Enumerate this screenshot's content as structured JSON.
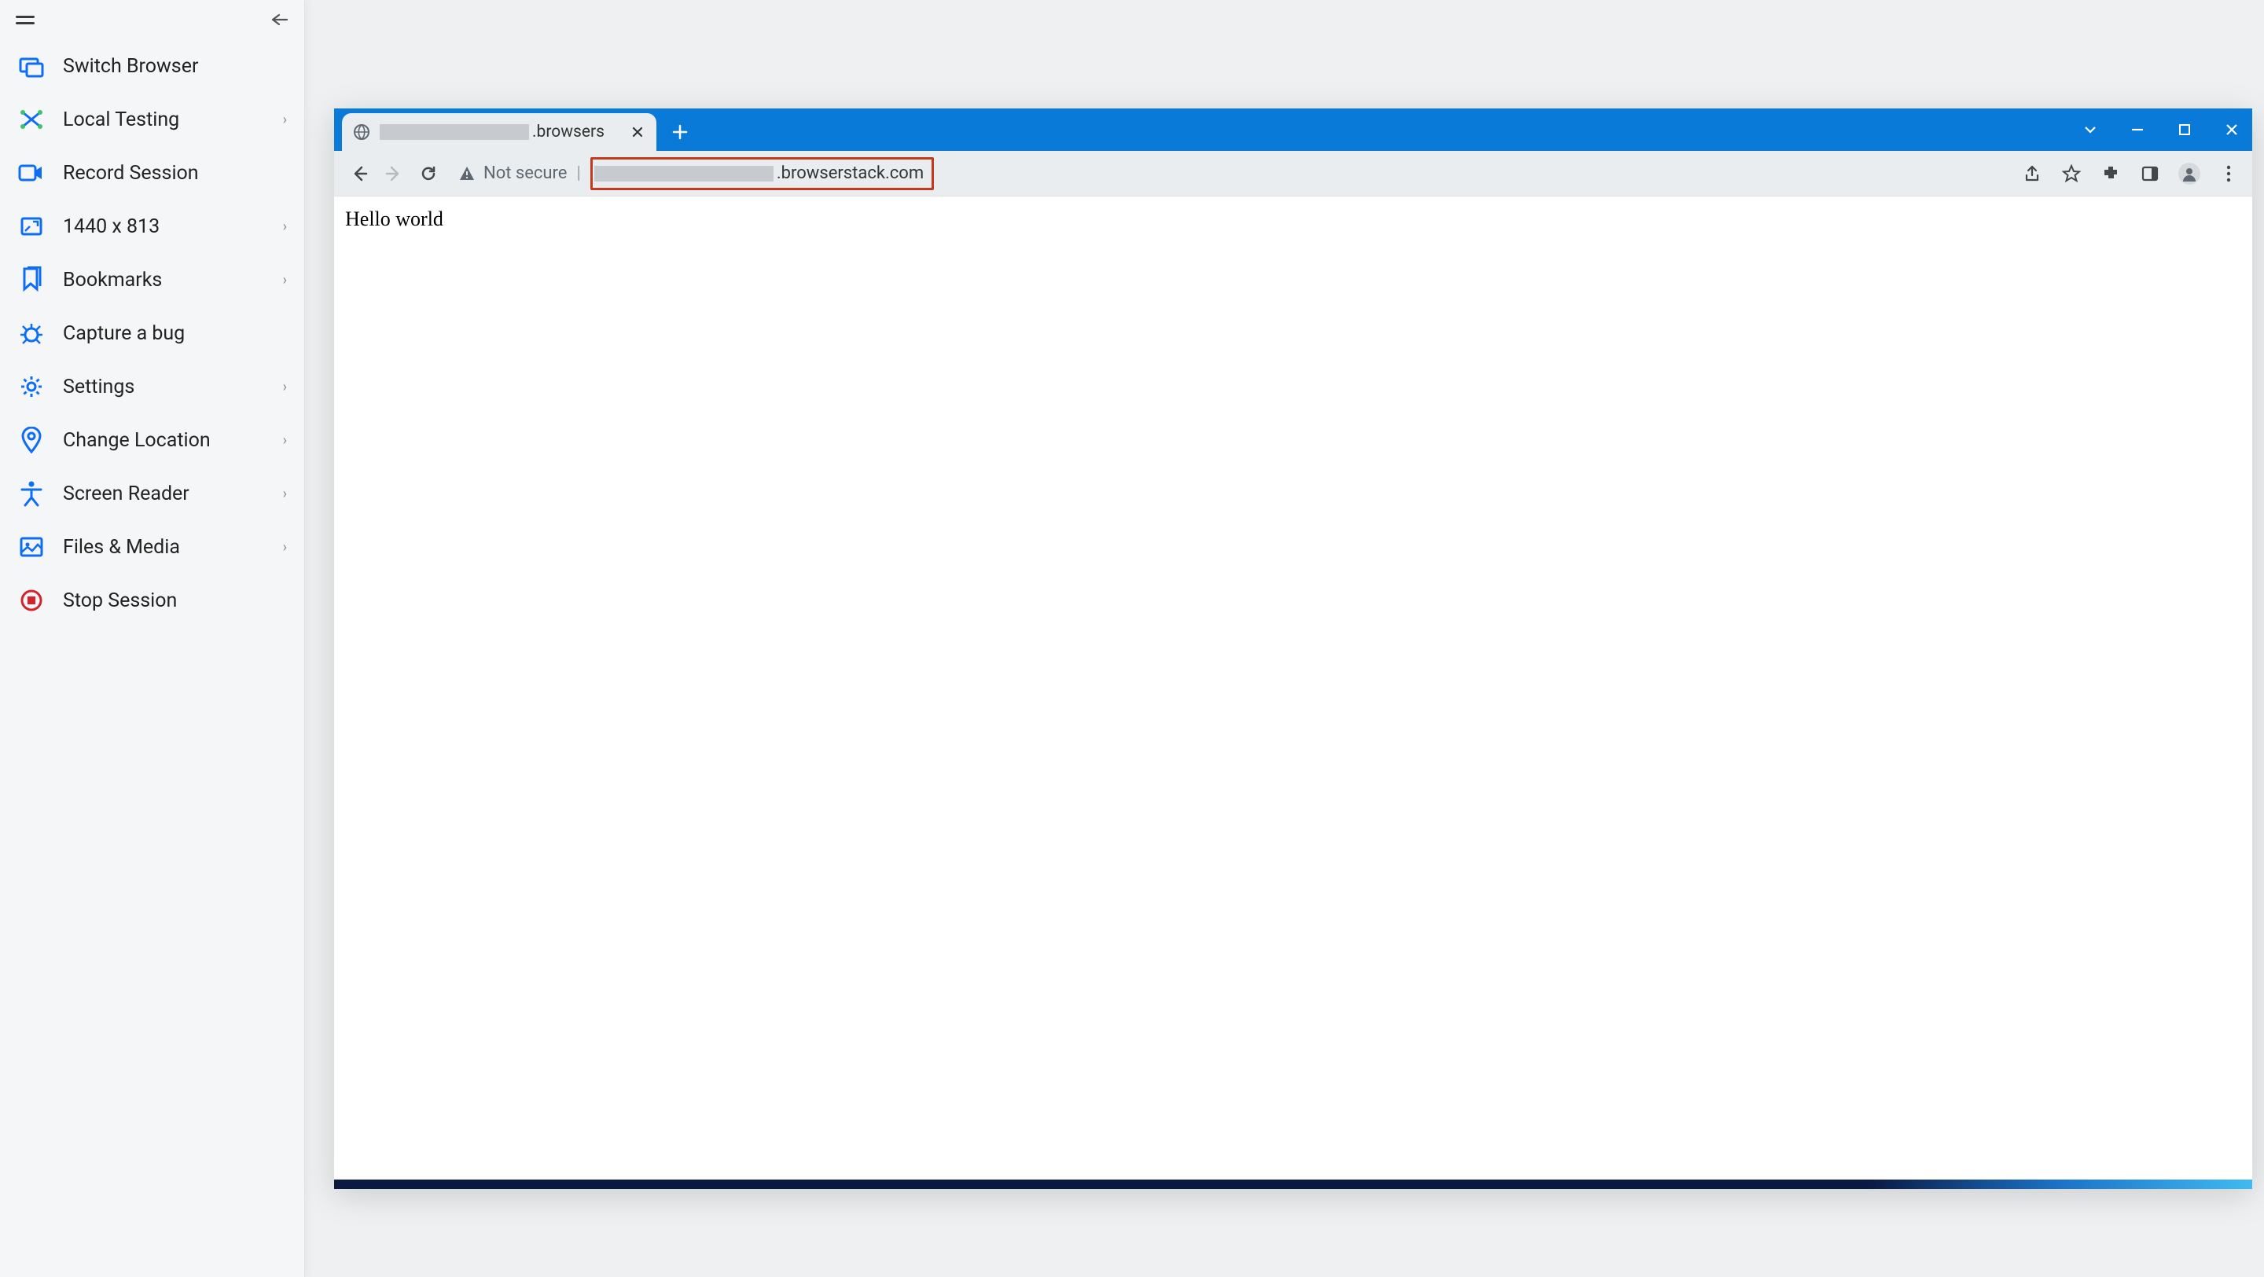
{
  "sidebar": {
    "items": [
      {
        "label": "Switch Browser",
        "icon": "switch-browser-icon",
        "has_sub": false,
        "color": "#0d6ef5"
      },
      {
        "label": "Local Testing",
        "icon": "local-testing-icon",
        "has_sub": true,
        "color": "#0d6ef5"
      },
      {
        "label": "Record Session",
        "icon": "record-session-icon",
        "has_sub": false,
        "color": "#0d6ef5"
      },
      {
        "label": "1440 x 813",
        "icon": "resolution-icon",
        "has_sub": true,
        "color": "#0d6ef5"
      },
      {
        "label": "Bookmarks",
        "icon": "bookmarks-icon",
        "has_sub": true,
        "color": "#0d6ef5"
      },
      {
        "label": "Capture a bug",
        "icon": "capture-bug-icon",
        "has_sub": false,
        "color": "#0d6ef5"
      },
      {
        "label": "Settings",
        "icon": "settings-icon",
        "has_sub": true,
        "color": "#0d6ef5"
      },
      {
        "label": "Change Location",
        "icon": "change-location-icon",
        "has_sub": true,
        "color": "#0d6ef5"
      },
      {
        "label": "Screen Reader",
        "icon": "screen-reader-icon",
        "has_sub": true,
        "color": "#0d6ef5"
      },
      {
        "label": "Files & Media",
        "icon": "files-media-icon",
        "has_sub": true,
        "color": "#0d6ef5"
      },
      {
        "label": "Stop Session",
        "icon": "stop-session-icon",
        "has_sub": false,
        "color": "#d8222a"
      }
    ]
  },
  "browser": {
    "tab": {
      "title_suffix": ".browsers"
    },
    "address_bar": {
      "not_secure_label": "Not secure",
      "url_suffix": ".browserstack.com"
    },
    "page": {
      "body_text": "Hello world"
    }
  }
}
